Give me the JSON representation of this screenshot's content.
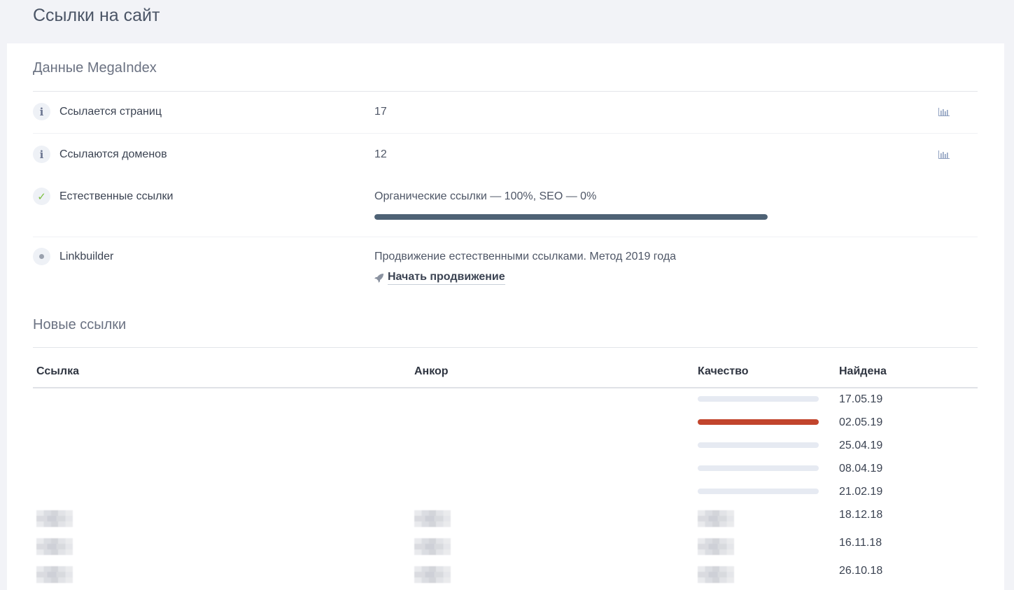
{
  "page": {
    "title": "Ссылки на сайт"
  },
  "megaindex": {
    "title": "Данные MegaIndex",
    "rows": [
      {
        "label": "Ссылается страниц",
        "value": "17",
        "icon": "info-icon",
        "chart_icon": "bar-chart-icon"
      },
      {
        "label": "Ссылаются доменов",
        "value": "12",
        "icon": "info-icon",
        "chart_icon": "bar-chart-icon"
      }
    ],
    "natural": {
      "label": "Естественные ссылки",
      "icon": "check-icon",
      "value": "Органические ссылки — 100%, SEO — 0%",
      "organic_fraction": 1.0
    },
    "linkbuilder": {
      "label": "Linkbuilder",
      "icon": "dot-icon",
      "value": "Продвижение естественными ссылками. Метод 2019 года",
      "action_label": "Начать продвижение",
      "action_icon": "rocket-icon"
    }
  },
  "new_links": {
    "title": "Новые ссылки",
    "columns": [
      "Ссылка",
      "Анкор",
      "Качество",
      "Найдена"
    ],
    "rows": [
      {
        "date": "17.05.19",
        "quality": "neutral"
      },
      {
        "date": "02.05.19",
        "quality": "bad"
      },
      {
        "date": "25.04.19",
        "quality": "neutral"
      },
      {
        "date": "08.04.19",
        "quality": "neutral"
      },
      {
        "date": "21.02.19",
        "quality": "neutral"
      },
      {
        "date": "18.12.18",
        "quality": "hidden"
      },
      {
        "date": "16.11.18",
        "quality": "hidden"
      },
      {
        "date": "26.10.18",
        "quality": "hidden"
      }
    ]
  },
  "colors": {
    "background": "#f2f3f7",
    "progress": "#4e6275",
    "quality_bad": "#c2452d",
    "quality_neutral": "#e6eaf2",
    "check": "#7cbf3f"
  }
}
